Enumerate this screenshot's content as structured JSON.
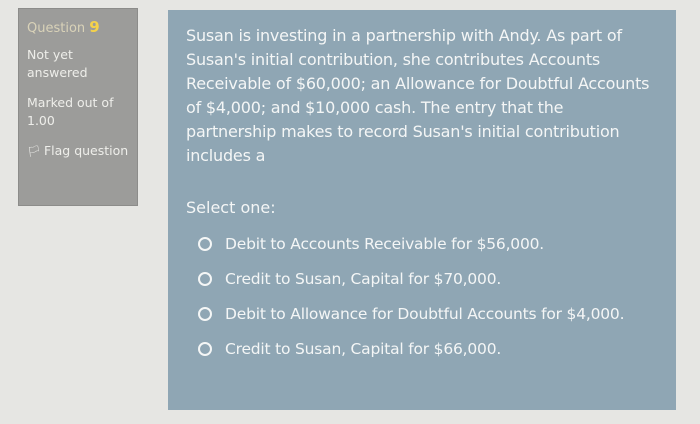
{
  "info": {
    "question_label": "Question",
    "question_number": "9",
    "status": "Not yet answered",
    "marked_out_of": "Marked out of 1.00",
    "flag_label": "Flag question"
  },
  "question": {
    "text": "Susan is investing in a partnership with Andy. As part of Susan's initial contribution, she contributes Accounts Receivable of $60,000; an Allowance for Doubtful Accounts of $4,000; and $10,000 cash. The entry that the partnership makes to record Susan's initial contribution includes a",
    "select_prompt": "Select one:",
    "options": [
      {
        "label": "Debit to Accounts Receivable for $56,000."
      },
      {
        "label": "Credit to Susan, Capital for $70,000."
      },
      {
        "label": "Debit to Allowance for Doubtful Accounts for $4,000."
      },
      {
        "label": "Credit to Susan, Capital for $66,000."
      }
    ]
  },
  "colors": {
    "page_bg": "#e6e6e3",
    "info_panel_bg": "#9c9c9a",
    "content_panel_bg": "#8fa6b4",
    "question_number_accent": "#f5d24a"
  },
  "icons": {
    "flag": "flag-icon",
    "radio": "radio-unchecked-icon"
  }
}
